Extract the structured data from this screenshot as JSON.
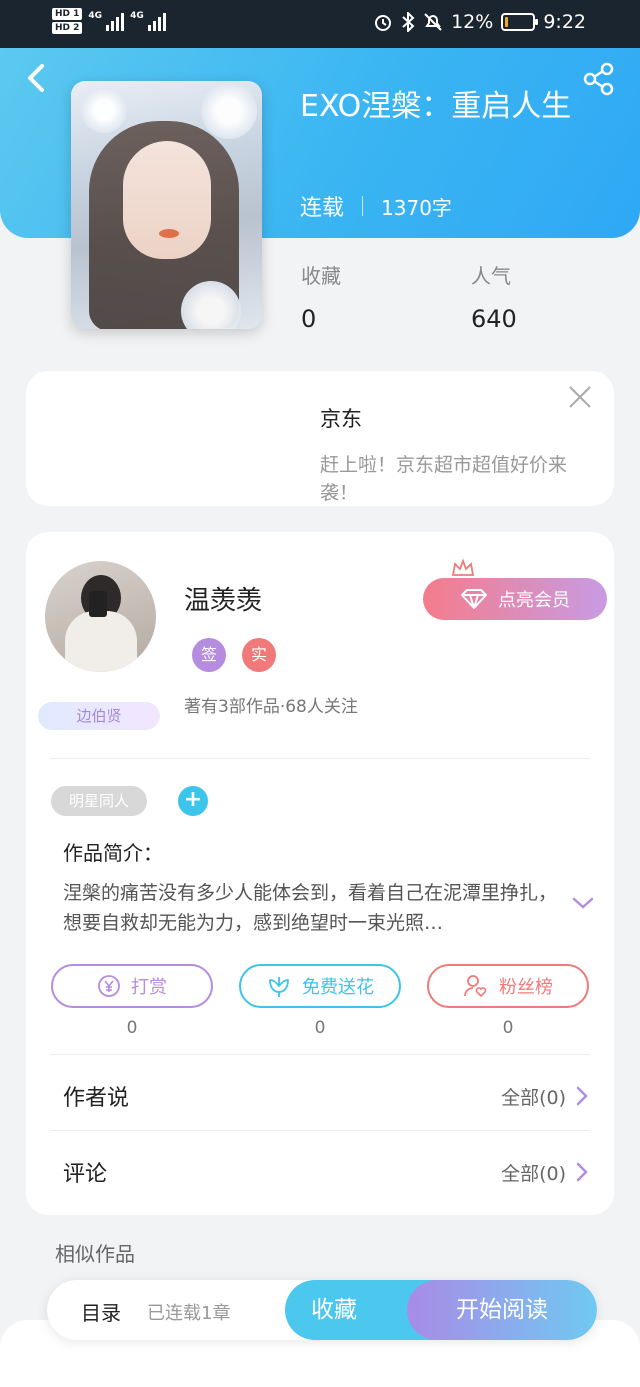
{
  "status_bar": {
    "hd1": "HD 1",
    "hd2": "HD 2",
    "net1": "4G",
    "net2": "4G",
    "battery": "12%",
    "battery_level": 0.12,
    "time": "9:22",
    "icons": [
      "alarm-icon",
      "bluetooth-icon",
      "mute-icon"
    ]
  },
  "book": {
    "title": "EXO涅槃：重启人生",
    "status": "连载",
    "word_count": "1370字",
    "favorites_label": "收藏",
    "favorites_value": "0",
    "popularity_label": "人气",
    "popularity_value": "640"
  },
  "ad": {
    "title": "京东",
    "description": "赶上啦！京东超市超值好价来袭！"
  },
  "author": {
    "name": "温羡羡",
    "badge_sign": "签",
    "badge_real": "实",
    "fan_badge": "边伯贤",
    "stats": "著有3部作品·68人关注",
    "vip_label": "点亮会员"
  },
  "tags": {
    "items": [
      "明星同人"
    ],
    "add": "+"
  },
  "intro": {
    "label": "作品简介：",
    "text": "涅槃的痛苦没有多少人能体会到，看着自己在泥潭里挣扎，想要自救却无能为力，感到绝望时一束光照…"
  },
  "actions": {
    "reward_label": "打赏",
    "reward_count": "0",
    "flower_label": "免费送花",
    "flower_count": "0",
    "fans_label": "粉丝榜",
    "fans_count": "0"
  },
  "author_says": {
    "label": "作者说",
    "more": "全部(0)"
  },
  "comments": {
    "label": "评论",
    "more": "全部(0)"
  },
  "similar": {
    "label": "相似作品"
  },
  "bottom_bar": {
    "toc": "目录",
    "chapters": "已连载1章",
    "favorite": "收藏",
    "read": "开始阅读"
  },
  "colors": {
    "header_blue": "#3ab5f2",
    "accent_cyan": "#3cc4ea",
    "accent_purple": "#b58ce0",
    "accent_red": "#f07a7a"
  }
}
